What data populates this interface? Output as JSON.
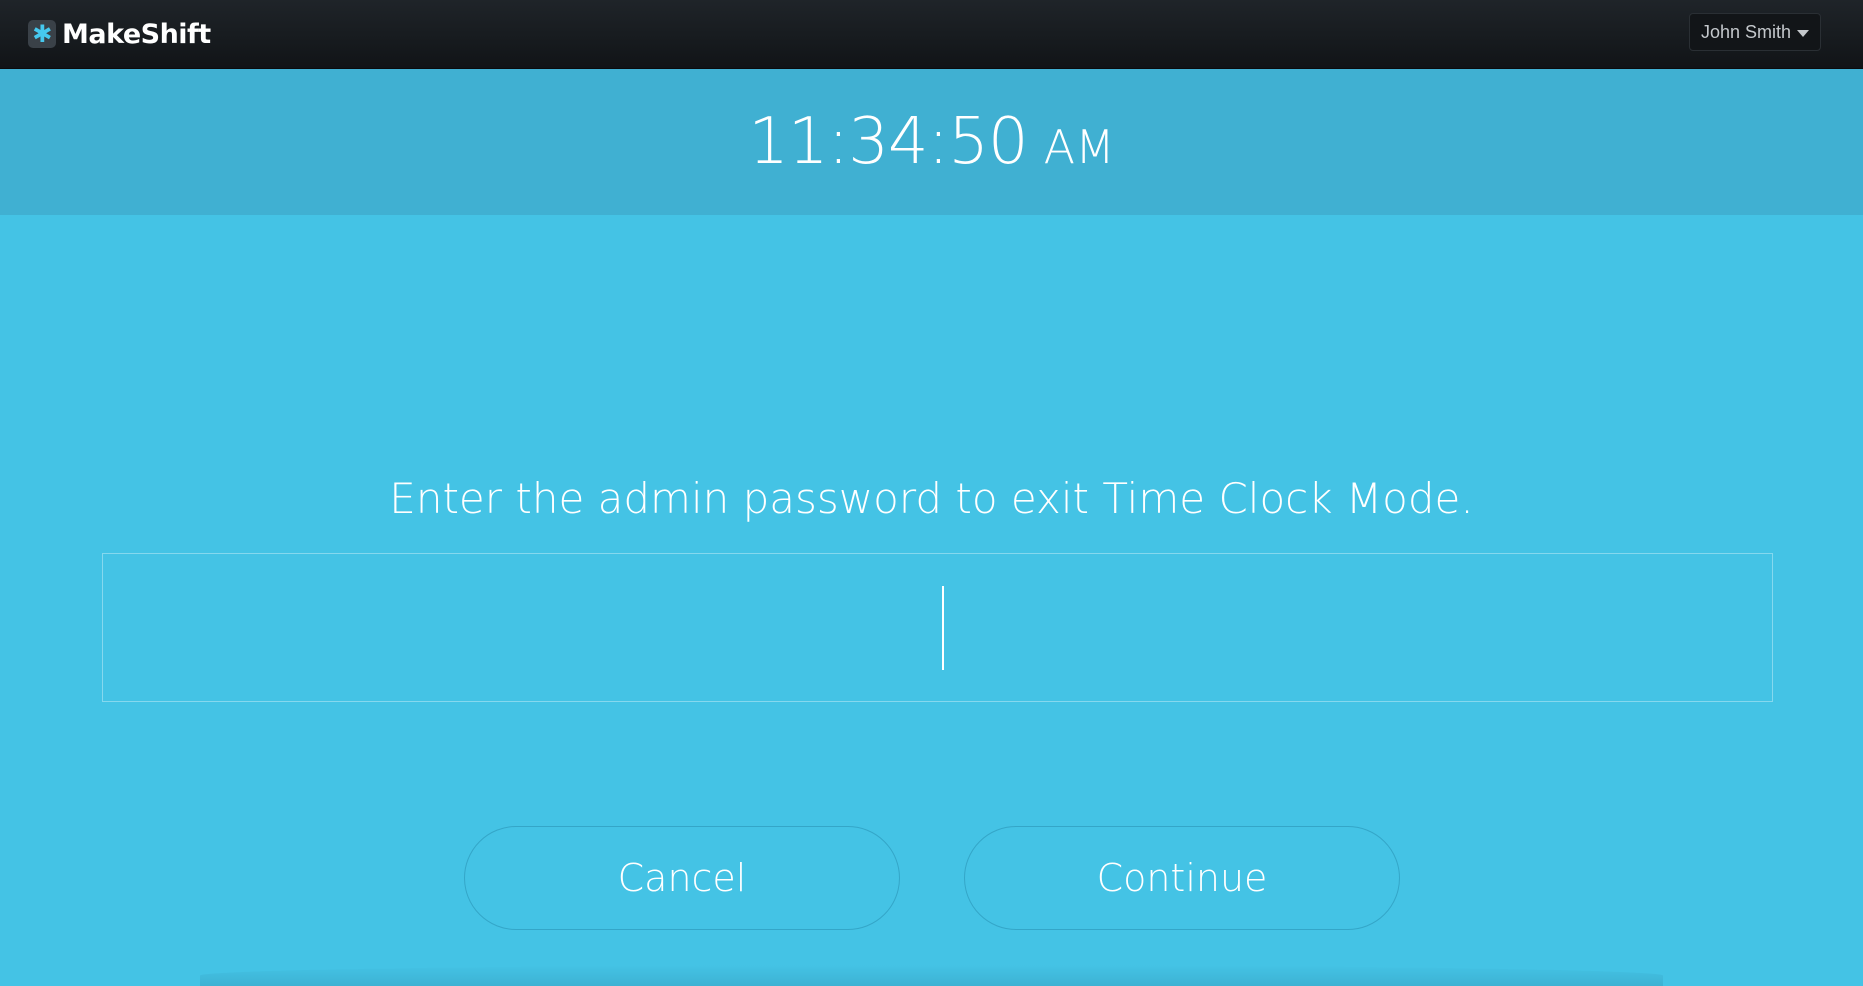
{
  "app": {
    "name": "MakeShift",
    "logo_icon": "asterisk-logo-icon"
  },
  "user_menu": {
    "label": "John Smith",
    "icon": "caret-down-icon"
  },
  "clock": {
    "time": "11:34:50",
    "ampm": "AM"
  },
  "exit_prompt": {
    "message": "Enter the admin password to exit Time Clock Mode.",
    "password_value": "",
    "placeholder": ""
  },
  "actions": {
    "cancel_label": "Cancel",
    "continue_label": "Continue"
  },
  "colors": {
    "navbar": "#16191d",
    "clock_band": "#40b0d2",
    "background": "#44c3e5",
    "logo_accent": "#46c8ee"
  }
}
